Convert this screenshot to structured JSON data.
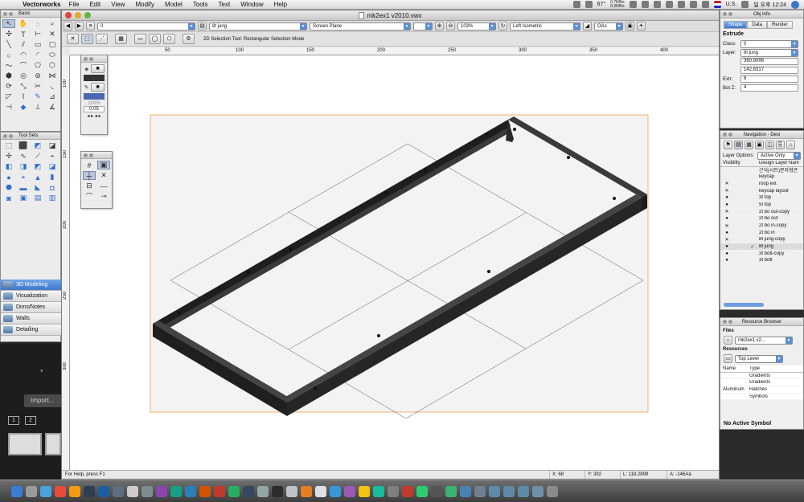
{
  "menubar": {
    "app": "Vectorworks",
    "items": [
      "File",
      "Edit",
      "View",
      "Modify",
      "Model",
      "Tools",
      "Text",
      "Window",
      "Help"
    ],
    "temp": "67°",
    "speed_up": "0.7KB/s",
    "speed_down": "0.3KB/s",
    "locale": "U.S.",
    "clock": "일 오후 12:24"
  },
  "window": {
    "title": "mk2ex1 v2010.vwx"
  },
  "toolbar1": {
    "class_value": "0",
    "layer_value": "8t jung",
    "plane_value": "Screen Plane",
    "zoom_value": "103%",
    "view_value": "Left Isometric",
    "render_value": "OAs"
  },
  "toolbar2": {
    "hint": "2D Selection Tool: Rectangular Selection Mode"
  },
  "rulers": {
    "top": [
      "50",
      "100",
      "150",
      "200",
      "250",
      "300",
      "350",
      "400"
    ],
    "left": [
      "100",
      "150",
      "200",
      "250",
      "300"
    ]
  },
  "basic_palette": {
    "title": "Basic"
  },
  "toolsets": {
    "title": "Tool Sets",
    "items": [
      "3D Modeling",
      "Visualization",
      "Dims/Notes",
      "Walls",
      "Detailing"
    ]
  },
  "attr_palette": {
    "opacity": "100%",
    "line_weight": "0.05"
  },
  "obj_info": {
    "title": "Obj Info",
    "tabs": [
      "Shape",
      "Data",
      "Render"
    ],
    "section": "Extrude",
    "class_label": "Class:",
    "class_value": "0",
    "layer_label": "Layer:",
    "layer_value": "8t jung",
    "field1": "360.9096",
    "field2": "142.8317",
    "extr_label": "Extr:",
    "extr_value": "8",
    "botz_label": "Bot Z:",
    "botz_value": "4"
  },
  "navigation": {
    "title": "Navigation - Desi",
    "layer_options_label": "Layer Options:",
    "layer_options_value": "Active Only",
    "col_visibility": "Visibility",
    "col_name": "Design Layer Nam",
    "layers": [
      {
        "v": "",
        "x": "",
        "name": "근식(시트)문자형큰"
      },
      {
        "v": "",
        "x": "",
        "name": "keycap"
      },
      {
        "v": "✕",
        "x": "",
        "name": "roop ext"
      },
      {
        "v": "✕",
        "x": "",
        "name": "keycap layout"
      },
      {
        "v": "●",
        "x": "",
        "name": "3t top"
      },
      {
        "v": "●",
        "x": "",
        "name": "5t top"
      },
      {
        "v": "✕",
        "x": "",
        "name": "2t bo out-copy"
      },
      {
        "v": "●",
        "x": "",
        "name": "2t bo out"
      },
      {
        "v": "✕",
        "x": "",
        "name": "2t bo in-copy"
      },
      {
        "v": "●",
        "x": "",
        "name": "2t bo in"
      },
      {
        "v": "✕",
        "x": "",
        "name": "8t jung-copy"
      },
      {
        "v": "●",
        "x": "✓",
        "name": "8t jung"
      },
      {
        "v": "●",
        "x": "",
        "name": "3t bott-copy"
      },
      {
        "v": "●",
        "x": "",
        "name": "3t bott"
      }
    ]
  },
  "resource_browser": {
    "title": "Resource Browser",
    "files_label": "Files",
    "file_value": "mk2ex1 v2...",
    "resources_label": "Resources",
    "level_value": "Top Level",
    "col_name": "Name",
    "col_type": "Type",
    "rows": [
      {
        "name": "",
        "type": "Gradients"
      },
      {
        "name": "",
        "type": "Gradients"
      },
      {
        "name": "Aluminum",
        "type": "Hatches"
      },
      {
        "name": "",
        "type": "Symbols"
      }
    ],
    "footer": "No Active Symbol"
  },
  "statusbar": {
    "help": "For Help, press F1",
    "x": "X:  68",
    "y": "Y:  392",
    "l": "L:  118.2899",
    "a": "A:  -146Aâ"
  },
  "desktop": {
    "import_label": "Import...",
    "page1": "1",
    "page2": "2"
  },
  "colors": {
    "model": "#2a2a2a",
    "page_border": "#f0b26a",
    "select_blue": "#3f78cc"
  }
}
